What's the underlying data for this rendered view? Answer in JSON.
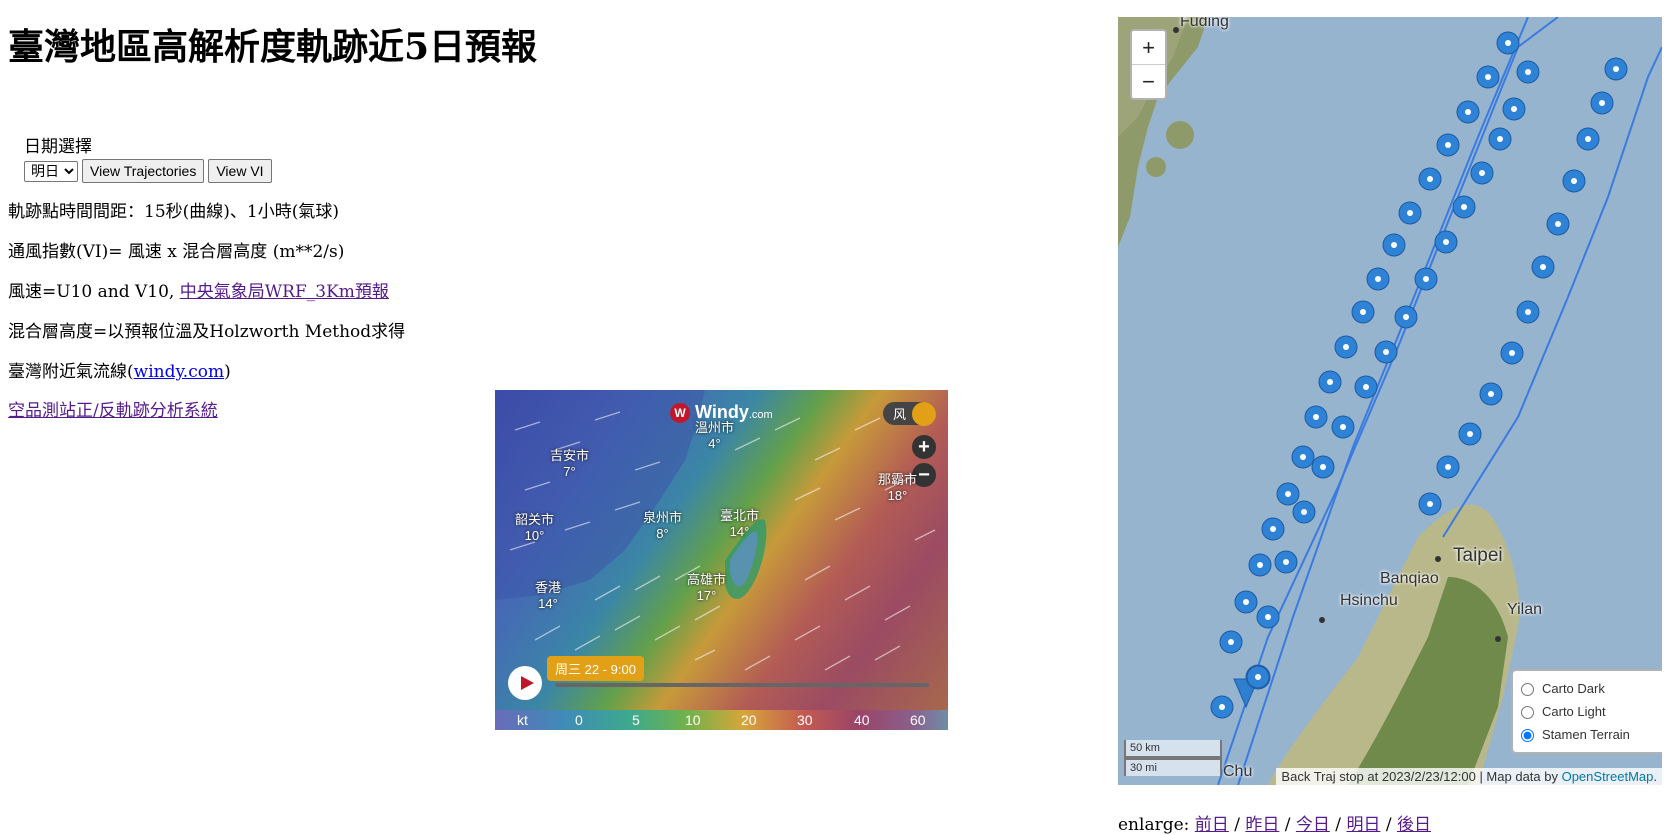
{
  "page": {
    "title": "臺灣地區高解析度軌跡近5日預報"
  },
  "date_select": {
    "label": "日期選擇",
    "selected": "明日",
    "view_trajectories_label": "View Trajectories",
    "view_vi_label": "View VI"
  },
  "info": {
    "line1": "軌跡點時間間距：15秒(曲線)、1小時(氣球)",
    "line2": "通風指數(VI)= 風速 x 混合層高度 (m**2/s)",
    "line3_prefix": "風速=U10 and V10, ",
    "line3_link": "中央氣象局WRF_3Km預報",
    "line4": "混合層高度=以預報位溫及Holzworth Method求得",
    "line5_prefix": "臺灣附近氣流線(",
    "line5_link": "windy.com",
    "line5_suffix": ")",
    "line6_link": "空品測站正/反軌跡分析系統"
  },
  "windy": {
    "logo_text": "Windy",
    "logo_suffix": ".com",
    "layer_badge": "风",
    "zoom_in": "+",
    "zoom_out": "−",
    "cities": [
      {
        "name": "溫州市",
        "temp": "4°"
      },
      {
        "name": "吉安市",
        "temp": "7°"
      },
      {
        "name": "韶关市",
        "temp": "10°"
      },
      {
        "name": "泉州市",
        "temp": "8°"
      },
      {
        "name": "臺北市",
        "temp": "14°"
      },
      {
        "name": "那霸市",
        "temp": "18°"
      },
      {
        "name": "香港",
        "temp": "14°"
      },
      {
        "name": "高雄市",
        "temp": "17°"
      }
    ],
    "sea_label": "香港",
    "time_label": "周三 22 - 9:00",
    "scale": [
      "kt",
      "0",
      "5",
      "10",
      "20",
      "30",
      "40",
      "60"
    ]
  },
  "map": {
    "zoom_in": "+",
    "zoom_out": "−",
    "labels": {
      "fuding": "Fuding",
      "taipei": "Taipei",
      "banqiao": "Banqiao",
      "hsinchu": "Hsinchu",
      "yilan": "Yilan",
      "chu": "Chu"
    },
    "layers": [
      "Carto Dark",
      "Carto Light",
      "Stamen Terrain"
    ],
    "selected_layer": "Stamen Terrain",
    "scale_km": "50 km",
    "scale_mi": "30 mi",
    "attribution_text": "Back Traj stop at 2023/2/23/12:00 | Map data by ",
    "attribution_link": "OpenStreetMap",
    "attribution_end": "."
  },
  "enlarge": {
    "label": "enlarge:",
    "links": [
      "前日",
      "昨日",
      "今日",
      "明日",
      "後日"
    ]
  }
}
